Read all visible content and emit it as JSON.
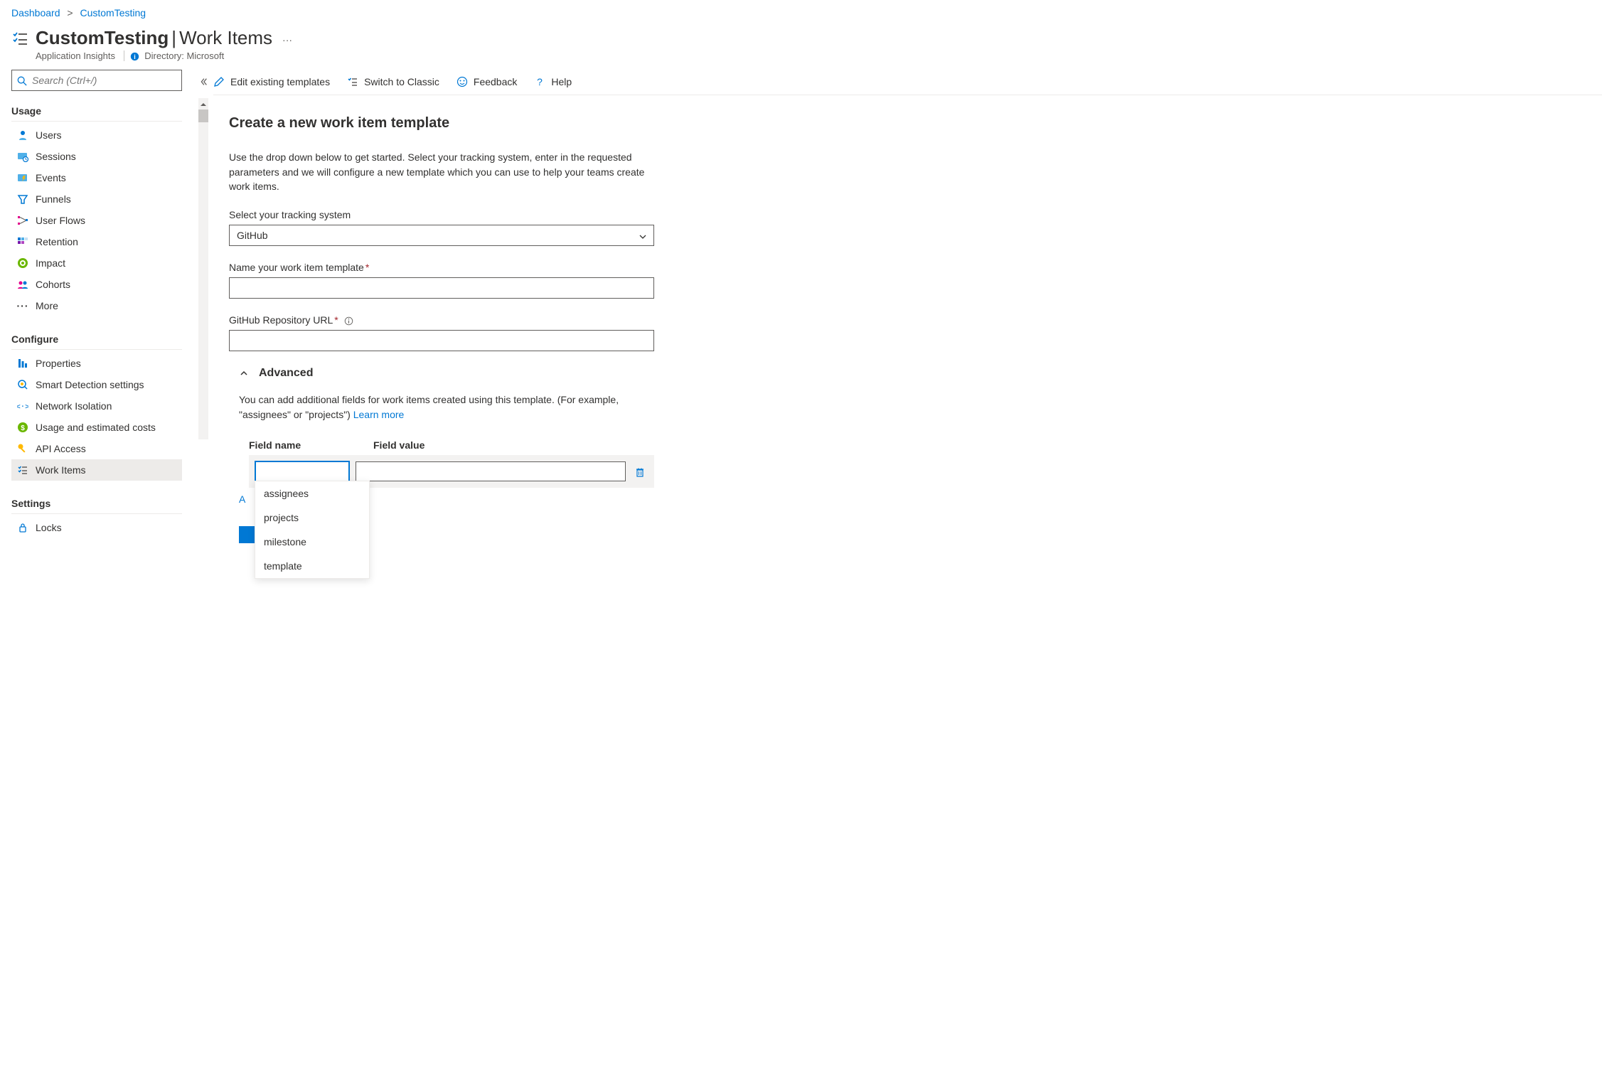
{
  "breadcrumb": {
    "dashboard": "Dashboard",
    "current": "CustomTesting"
  },
  "header": {
    "title_prefix": "CustomTesting",
    "title_suffix": "Work Items",
    "subtitle": "Application Insights",
    "directory_label": "Directory: Microsoft"
  },
  "sidebar": {
    "search_placeholder": "Search (Ctrl+/)",
    "sections": {
      "usage": {
        "title": "Usage",
        "items": [
          "Users",
          "Sessions",
          "Events",
          "Funnels",
          "User Flows",
          "Retention",
          "Impact",
          "Cohorts",
          "More"
        ]
      },
      "configure": {
        "title": "Configure",
        "items": [
          "Properties",
          "Smart Detection settings",
          "Network Isolation",
          "Usage and estimated costs",
          "API Access",
          "Work Items"
        ]
      },
      "settings": {
        "title": "Settings",
        "items": [
          "Locks"
        ]
      }
    }
  },
  "toolbar": {
    "edit": "Edit existing templates",
    "switch": "Switch to Classic",
    "feedback": "Feedback",
    "help": "Help"
  },
  "content": {
    "heading": "Create a new work item template",
    "description": "Use the drop down below to get started. Select your tracking system, enter in the requested parameters and we will configure a new template which you can use to help your teams create work items.",
    "select_label": "Select your tracking system",
    "select_value": "GitHub",
    "name_label": "Name your work item template",
    "repo_label": "GitHub Repository URL",
    "advanced": {
      "title": "Advanced",
      "desc_prefix": "You can add additional fields for work items created using this template. (For example, \"assignees\" or \"projects\") ",
      "learn_more": "Learn more",
      "col_name": "Field name",
      "col_value": "Field value",
      "add_label": "A",
      "dropdown_options": [
        "assignees",
        "projects",
        "milestone",
        "template"
      ]
    }
  }
}
